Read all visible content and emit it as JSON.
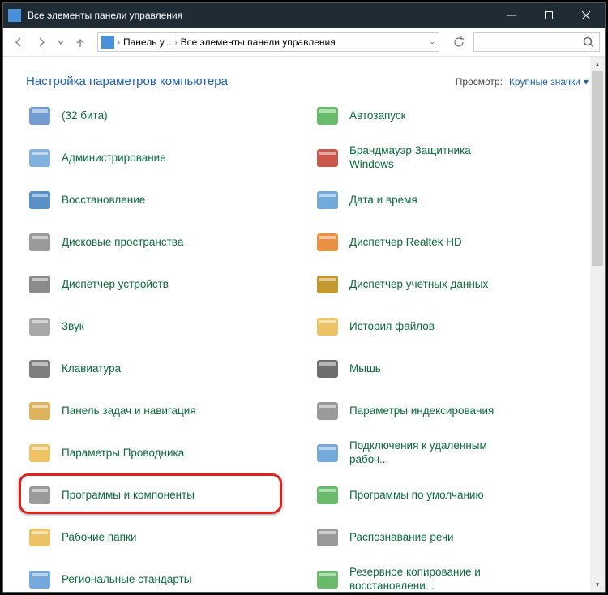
{
  "titlebar": {
    "title": "Все элементы панели управления"
  },
  "toolbar": {
    "breadcrumb1": "Панель у...",
    "breadcrumb2": "Все элементы панели управления"
  },
  "header": {
    "page_title": "Настройка параметров компьютера",
    "viewby_label": "Просмотр:",
    "viewby_value": "Крупные значки"
  },
  "items": {
    "left": [
      "(32 бита)",
      "Администрирование",
      "Восстановление",
      "Дисковые пространства",
      "Диспетчер устройств",
      "Звук",
      "Клавиатура",
      "Панель задач и навигация",
      "Параметры Проводника",
      "Программы и компоненты",
      "Рабочие папки",
      "Региональные стандарты"
    ],
    "right": [
      "Автозапуск",
      "Брандмауэр Защитника Windows",
      "Дата и время",
      "Диспетчер Realtek HD",
      "Диспетчер учетных данных",
      "История файлов",
      "Мышь",
      "Параметры индексирования",
      "Подключения к удаленным рабоч...",
      "Программы по умолчанию",
      "Распознавание речи",
      "Резервное копирование и восстановлени..."
    ]
  },
  "highlight": {
    "index": 9
  }
}
